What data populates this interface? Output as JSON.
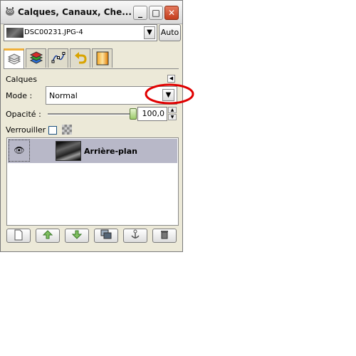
{
  "window": {
    "title": "Calques, Canaux, Che..."
  },
  "window_controls": {
    "minimize": "_",
    "maximize": "□",
    "close": "✕"
  },
  "image_selector": {
    "value": "DSC00231.JPG-4",
    "auto_label": "Auto"
  },
  "tabs": [
    {
      "icon": "layers-icon",
      "active": true
    },
    {
      "icon": "channels-icon",
      "active": false
    },
    {
      "icon": "paths-icon",
      "active": false
    },
    {
      "icon": "undo-history-icon",
      "active": false
    },
    {
      "icon": "gradient-icon",
      "active": false
    }
  ],
  "layers_panel": {
    "title": "Calques",
    "mode_label": "Mode :",
    "mode_value": "Normal",
    "opacity_label": "Opacité :",
    "opacity_value": "100,0",
    "opacity_level": 1.0,
    "lock_label": "Verrouiller :"
  },
  "layers": [
    {
      "name": "Arrière-plan",
      "visible": true
    }
  ],
  "bottom_toolbar": [
    {
      "icon": "new-layer-icon"
    },
    {
      "icon": "raise-layer-icon"
    },
    {
      "icon": "lower-layer-icon"
    },
    {
      "icon": "duplicate-layer-icon"
    },
    {
      "icon": "anchor-layer-icon"
    },
    {
      "icon": "delete-layer-icon"
    }
  ],
  "colors": {
    "annotation": "#e00000",
    "selected_row": "#b8b8c8",
    "active_tab_accent": "#f0b03a"
  }
}
